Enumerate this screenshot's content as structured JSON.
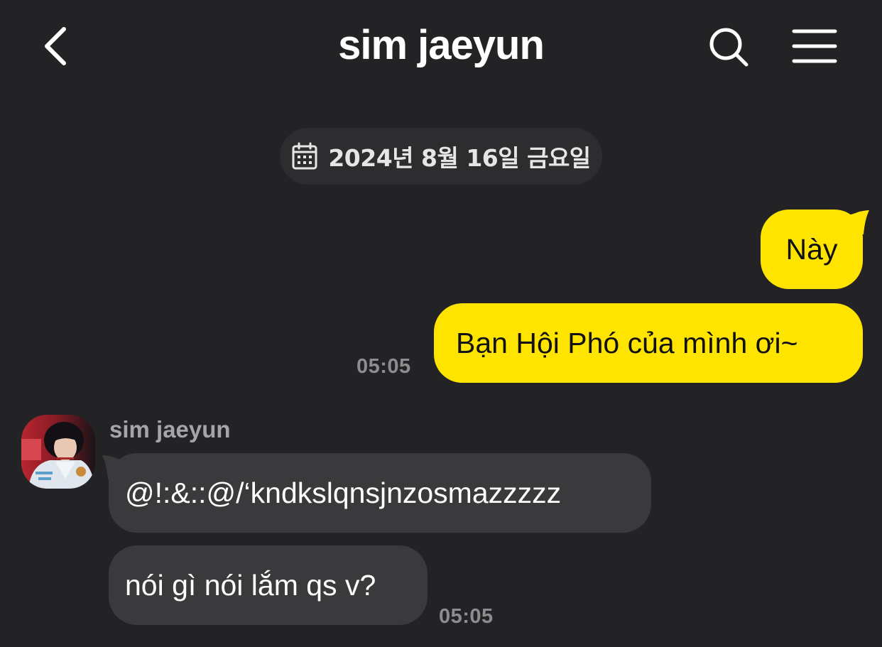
{
  "header": {
    "title": "sim jaeyun",
    "back_icon": "chevron-left-icon",
    "search_icon": "search-icon",
    "menu_icon": "hamburger-menu-icon"
  },
  "date_divider": {
    "icon": "calendar-icon",
    "text": "2024년 8월 16일 금요일"
  },
  "messages_out": [
    {
      "text": "Này"
    },
    {
      "text": "Bạn Hội Phó của mình ơi~",
      "time": "05:05"
    }
  ],
  "incoming": {
    "sender_name": "sim jaeyun",
    "avatar_icon": "profile-photo-avatar",
    "messages": [
      {
        "text": "@!:&::@/‘kndkslqnsjnzosmazzzzz"
      },
      {
        "text": "nói gì nói lắm qs v?",
        "time": "05:05"
      }
    ]
  },
  "colors": {
    "background": "#232325",
    "outgoing_bubble": "#ffe400",
    "incoming_bubble": "#3a3a3d",
    "date_chip": "#2d2d30",
    "timestamp": "#8d8d90"
  }
}
